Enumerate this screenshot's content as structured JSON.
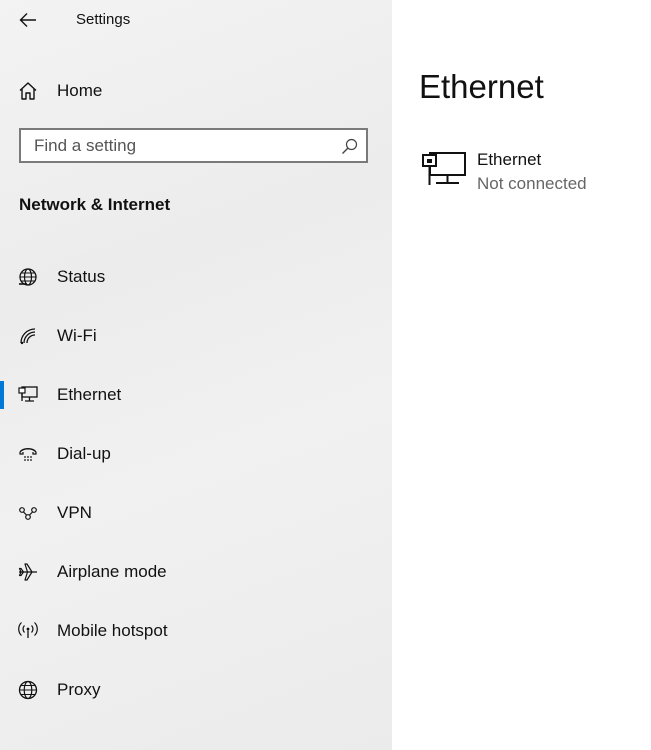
{
  "header": {
    "back_icon": "back-arrow-icon",
    "title": "Settings"
  },
  "home": {
    "icon": "home-icon",
    "label": "Home"
  },
  "search": {
    "placeholder": "Find a setting",
    "value": "",
    "icon": "search-icon"
  },
  "section": {
    "title": "Network & Internet"
  },
  "nav": {
    "items": [
      {
        "label": "Status",
        "icon": "globe-status-icon",
        "selected": false
      },
      {
        "label": "Wi-Fi",
        "icon": "wifi-icon",
        "selected": false
      },
      {
        "label": "Ethernet",
        "icon": "ethernet-icon",
        "selected": true
      },
      {
        "label": "Dial-up",
        "icon": "dialup-icon",
        "selected": false
      },
      {
        "label": "VPN",
        "icon": "vpn-icon",
        "selected": false
      },
      {
        "label": "Airplane mode",
        "icon": "airplane-icon",
        "selected": false
      },
      {
        "label": "Mobile hotspot",
        "icon": "hotspot-icon",
        "selected": false
      },
      {
        "label": "Proxy",
        "icon": "globe-icon",
        "selected": false
      }
    ]
  },
  "main": {
    "title": "Ethernet",
    "connection": {
      "name": "Ethernet",
      "status": "Not connected",
      "icon": "ethernet-network-icon"
    }
  },
  "colors": {
    "accent": "#0078d7",
    "sidebar_bg": "#efefef",
    "secondary_text": "#666666"
  }
}
